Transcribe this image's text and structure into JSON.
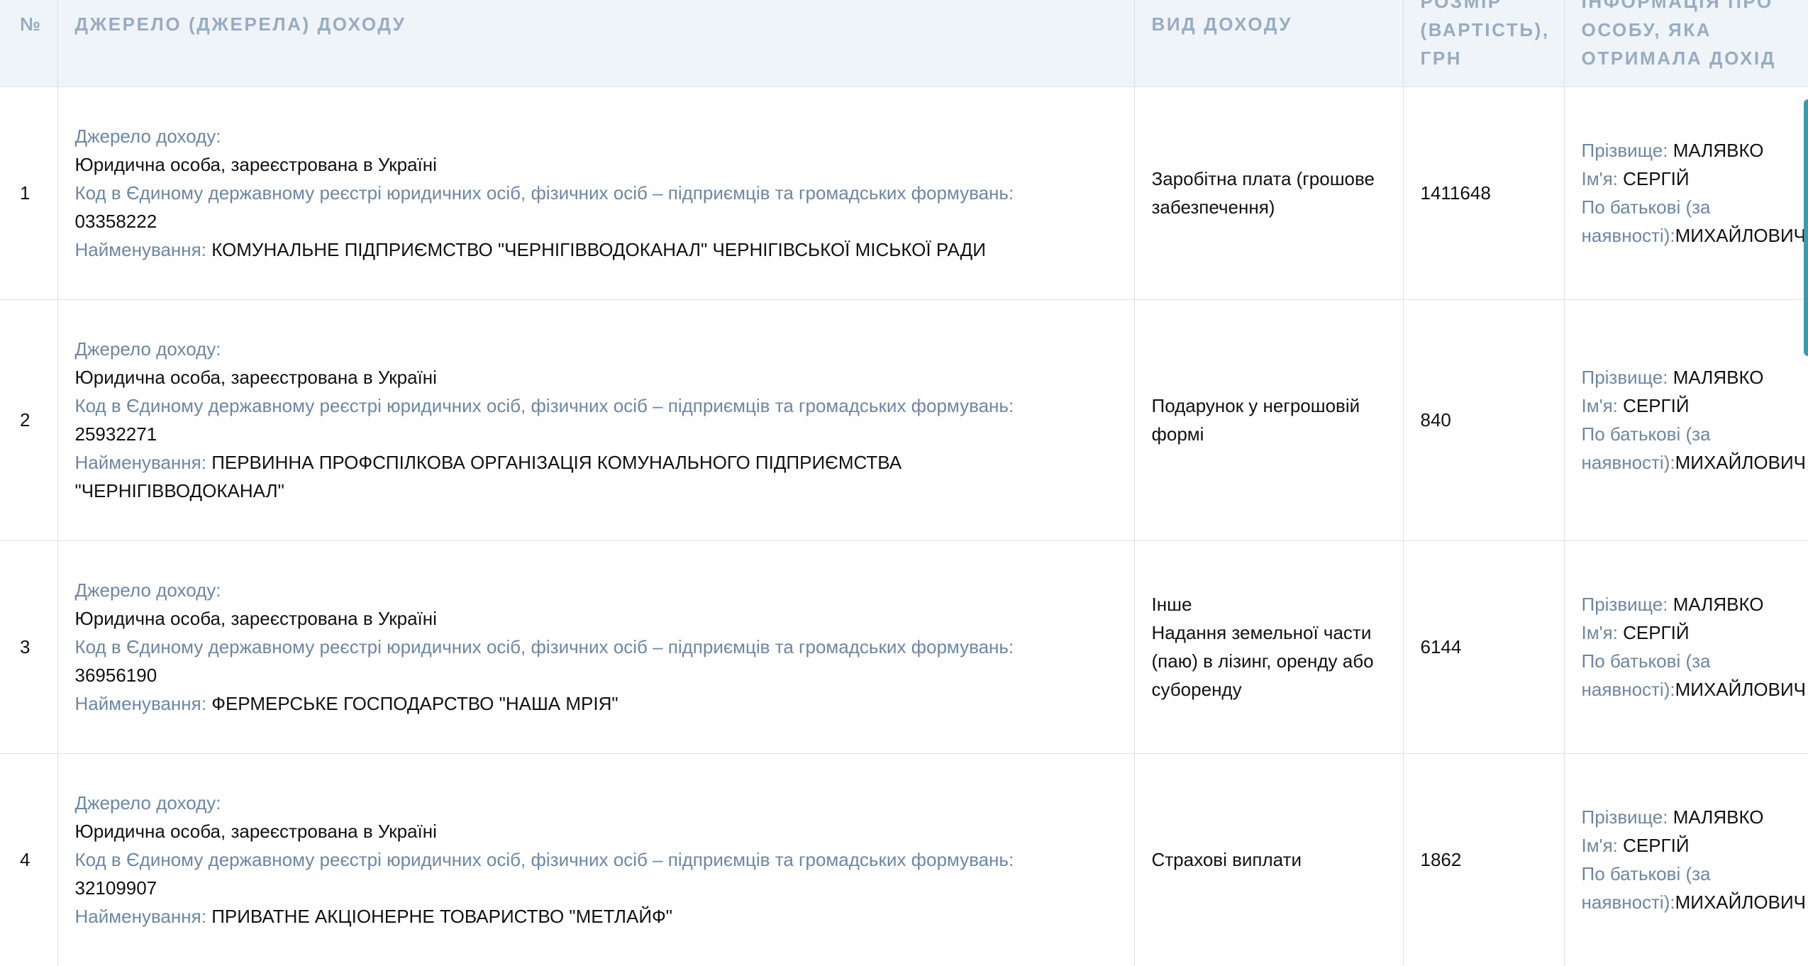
{
  "table": {
    "headers": {
      "no": "№",
      "source": "ДЖЕРЕЛО (ДЖЕРЕЛА) ДОХОДУ",
      "type": "ВИД ДОХОДУ",
      "amount_top": "РОЗМІР",
      "amount_line1": "(ВАРТІСТЬ),",
      "amount_line2": "ГРН",
      "person_top": "ІНФОРМАЦІЯ ПРО",
      "person_line1": "ОСОБУ, ЯКА",
      "person_line2": "ОТРИМАЛА ДОХІД"
    },
    "labels": {
      "source": "Джерело доходу:",
      "code": "Код в Єдиному державному реєстрі юридичних осіб, фізичних осіб – підприємців та громадських формувань:",
      "name": "Найменування: ",
      "surname": "Прізвище: ",
      "first_name": "Ім'я: ",
      "patronymic_1": "По батькові (за",
      "patronymic_2": "наявності):"
    },
    "rows": [
      {
        "no": "1",
        "source_type": "Юридична особа, зареєстрована в Україні",
        "code": "03358222",
        "name": "КОМУНАЛЬНЕ ПІДПРИЄМСТВО \"ЧЕРНІГІВВОДОКАНАЛ\" ЧЕРНІГІВСЬКОЇ МІСЬКОЇ РАДИ",
        "income_type": "Заробітна плата (грошове забезпечення)",
        "amount": "1411648",
        "surname": "МАЛЯВКО",
        "first_name": "СЕРГІЙ",
        "patronymic": "МИХАЙЛОВИЧ"
      },
      {
        "no": "2",
        "source_type": "Юридична особа, зареєстрована в Україні",
        "code": "25932271",
        "name": "ПЕРВИННА ПРОФСПІЛКОВА ОРГАНІЗАЦІЯ КОМУНАЛЬНОГО ПІДПРИЄМСТВА \"ЧЕРНІГІВВОДОКАНАЛ\"",
        "income_type": "Подарунок у негрошовій формі",
        "amount": "840",
        "surname": "МАЛЯВКО",
        "first_name": "СЕРГІЙ",
        "patronymic": "МИХАЙЛОВИЧ"
      },
      {
        "no": "3",
        "source_type": "Юридична особа, зареєстрована в Україні",
        "code": "36956190",
        "name": "ФЕРМЕРСЬКЕ ГОСПОДАРСТВО \"НАША МРІЯ\"",
        "income_type": "Інше",
        "income_type_detail": "Надання земельної части (паю) в лізинг, оренду або суборенду",
        "amount": "6144",
        "surname": "МАЛЯВКО",
        "first_name": "СЕРГІЙ",
        "patronymic": "МИХАЙЛОВИЧ"
      },
      {
        "no": "4",
        "source_type": "Юридична особа, зареєстрована в Україні",
        "code": "32109907",
        "name": "ПРИВАТНЕ АКЦІОНЕРНЕ ТОВАРИСТВО \"МЕТЛАЙФ\"",
        "income_type": "Страхові виплати",
        "amount": "1862",
        "surname": "МАЛЯВКО",
        "first_name": "СЕРГІЙ",
        "patronymic": "МИХАЙЛОВИЧ"
      }
    ]
  },
  "colors": {
    "header_bg": "#eef4f8",
    "header_text": "#98acc1",
    "label_text": "#6d87a3",
    "value_text": "#111111",
    "scroll_handle": "#2f9fb3"
  }
}
